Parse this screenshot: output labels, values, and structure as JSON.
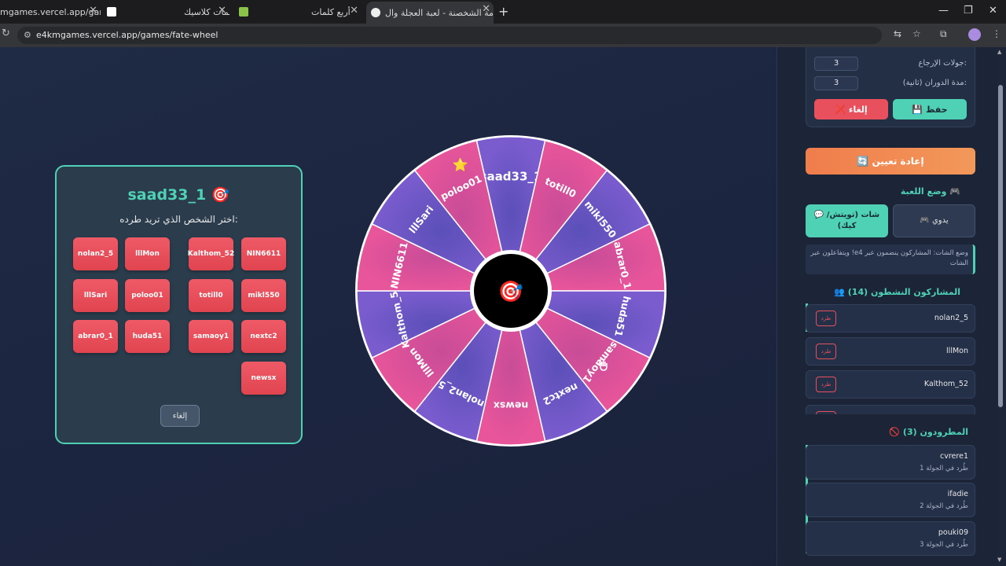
{
  "browser": {
    "tabs": [
      {
        "title": "mgames.vercel.app/games/"
      },
      {
        "title": "كلمات كلاسيك"
      },
      {
        "title": "أربع كلمات"
      },
      {
        "title": "دوامة الشخصنة - لعبة العجلة وال"
      }
    ],
    "url": "e4kmgames.vercel.app/games/fate-wheel"
  },
  "modal": {
    "title": "saad33_1 🎯",
    "subtitle": "اختر الشخص الذي تريد طرده:",
    "players": [
      "NIN6611",
      "Kalthom_52",
      "lllMon",
      "nolan2_5",
      "mikl550",
      "totill0",
      "poloo01",
      "lllSari",
      "nextc2",
      "samaoy1",
      "huda51",
      "abrar0_1",
      "newsx"
    ],
    "cancel_label": "إلغاء"
  },
  "wheel": {
    "center_icon": "🎯",
    "star_icon": "⭐",
    "segments": [
      "saad33_1",
      "totill0",
      "mikl550",
      "abrar0_1",
      "huda51",
      "samaoy1",
      "nextc2",
      "newsx",
      "nolan2_5",
      "lllMon",
      "Kalthom_52",
      "NIN6611",
      "lllSari",
      "poloo01"
    ],
    "colors": {
      "pink": "#e8559a",
      "purple": "#7b5ccf"
    }
  },
  "sidebar": {
    "settings": {
      "rounds_label": "جولات الإرجاع:",
      "rounds_value": "3",
      "duration_label": "مدة الدوران (ثانية):",
      "duration_value": "3",
      "save_label": "💾 حفظ",
      "cancel_label": "❌ إلغاء"
    },
    "reset_label": "🔄 إعادة تعيين",
    "mode": {
      "title": "وضع اللعبة 🎮",
      "chat_label": "💬 شات (تويتش/كيك)",
      "manual_label": "🎮 يدوي",
      "note": "وضع الشات: المشاركون ينضمون عبر e4! ويتفاعلون عبر الشات"
    },
    "active": {
      "title": "👥 المشاركون النشطون (14)",
      "kick_label": "طرد",
      "players": [
        "nolan2_5",
        "lllMon",
        "Kalthom_52"
      ]
    },
    "eliminated": {
      "title": "🚫 المطرودون (3)",
      "players": [
        {
          "name": "cvrere1",
          "round": "طُرد في الجولة 1"
        },
        {
          "name": "ifadie",
          "round": "طُرد في الجولة 2"
        },
        {
          "name": "pouki09",
          "round": "طُرد في الجولة 3"
        }
      ]
    }
  }
}
